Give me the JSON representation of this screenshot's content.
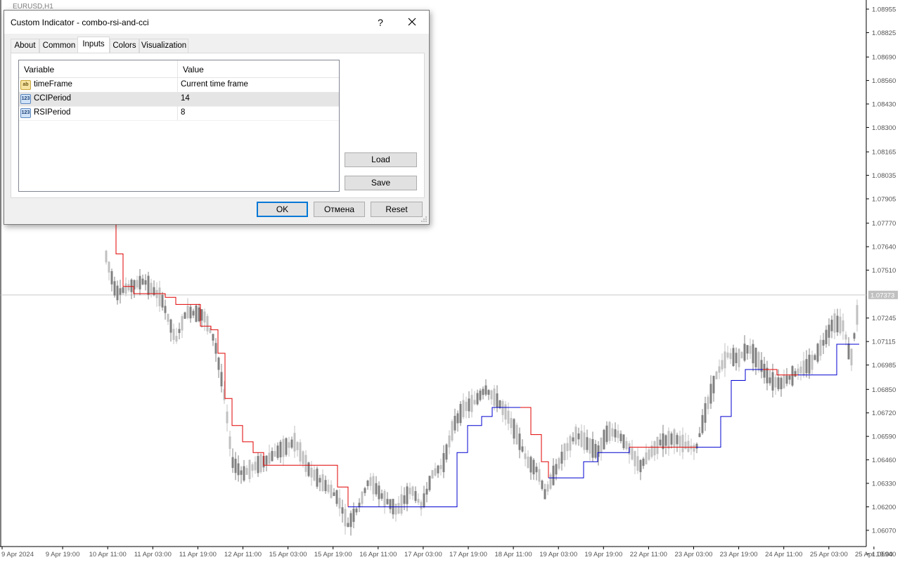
{
  "chart": {
    "symbol": "EURUSD,H1",
    "current_price": "1.07373",
    "price_ticks": [
      "1.08955",
      "1.08825",
      "1.08690",
      "1.08560",
      "1.08430",
      "1.08300",
      "1.08165",
      "1.08035",
      "1.07905",
      "1.07770",
      "1.07640",
      "1.07510",
      "1.07245",
      "1.07115",
      "1.06985",
      "1.06850",
      "1.06720",
      "1.06590",
      "1.06460",
      "1.06330",
      "1.06200",
      "1.06070",
      "1.05940"
    ],
    "time_ticks": [
      "9 Apr 2024",
      "9 Apr 19:00",
      "10 Apr 11:00",
      "11 Apr 03:00",
      "11 Apr 19:00",
      "12 Apr 11:00",
      "15 Apr 03:00",
      "15 Apr 19:00",
      "16 Apr 11:00",
      "17 Apr 03:00",
      "17 Apr 19:00",
      "18 Apr 11:00",
      "19 Apr 03:00",
      "19 Apr 19:00",
      "22 Apr 11:00",
      "23 Apr 03:00",
      "23 Apr 19:00",
      "24 Apr 11:00",
      "25 Apr 03:00",
      "25 Apr 19:00"
    ],
    "colors": {
      "candle": "#808080",
      "candle_light": "#c0c0c0",
      "line_down": "#e00000",
      "line_up": "#0000d0",
      "grid": "#c8c8c8"
    }
  },
  "dialog": {
    "title": "Custom Indicator - combo-rsi-and-cci",
    "help_label": "?",
    "tabs": [
      {
        "label": "About"
      },
      {
        "label": "Common"
      },
      {
        "label": "Inputs"
      },
      {
        "label": "Colors"
      },
      {
        "label": "Visualization"
      }
    ],
    "active_tab": "Inputs",
    "grid": {
      "header_variable": "Variable",
      "header_value": "Value",
      "rows": [
        {
          "icon": "ab",
          "type": "string",
          "name": "timeFrame",
          "value": "Current time frame"
        },
        {
          "icon": "123",
          "type": "number",
          "name": "CCIPeriod",
          "value": "14"
        },
        {
          "icon": "123",
          "type": "number",
          "name": "RSIPeriod",
          "value": "8"
        }
      ]
    },
    "buttons": {
      "load": "Load",
      "save": "Save",
      "ok": "OK",
      "cancel": "Отмена",
      "reset": "Reset"
    }
  }
}
